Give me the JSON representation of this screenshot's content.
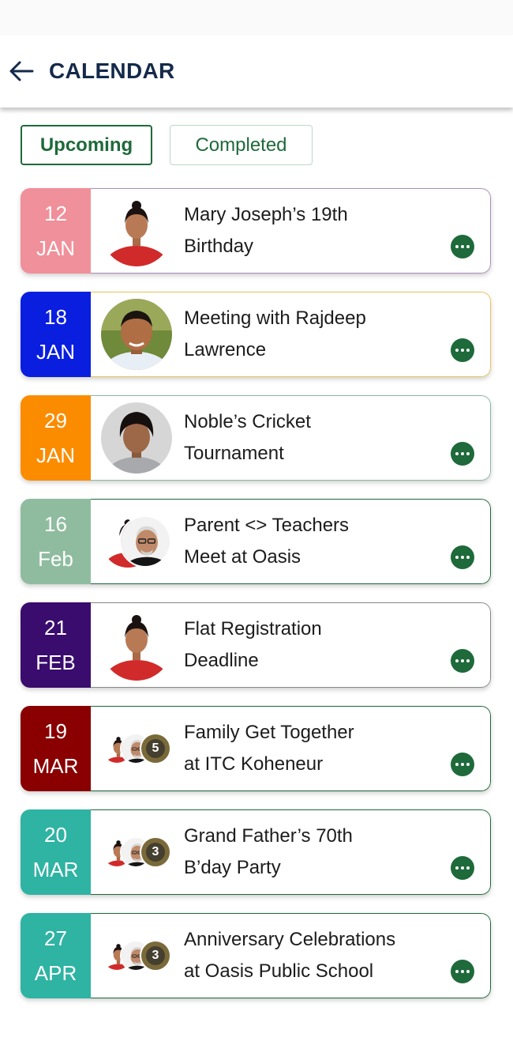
{
  "header": {
    "title": "CALENDAR",
    "back_icon": "arrow-left-icon"
  },
  "tabs": [
    {
      "label": "Upcoming",
      "active": true
    },
    {
      "label": "Completed",
      "active": false
    }
  ],
  "colors": {
    "accent": "#1e6a3a",
    "title": "#142a4a"
  },
  "events": [
    {
      "day": "12",
      "month": "JAN",
      "title_line1": "Mary Joseph’s 19th",
      "title_line2": "Birthday",
      "date_color": "#f0909a",
      "border_color": "#a88fb8",
      "avatar": "woman"
    },
    {
      "day": "18",
      "month": "JAN",
      "title_line1": "Meeting with Rajdeep",
      "title_line2": "Lawrence",
      "date_color": "#0a1ee0",
      "border_color": "#e8c45a",
      "avatar": "man"
    },
    {
      "day": "29",
      "month": "JAN",
      "title_line1": "Noble’s Cricket",
      "title_line2": "Tournament",
      "date_color": "#fb8c00",
      "border_color": "#8ab8a0",
      "avatar": "boy"
    },
    {
      "day": "16",
      "month": "Feb",
      "title_line1": "Parent <> Teachers",
      "title_line2": "Meet at Oasis",
      "date_color": "#8fbc9f",
      "border_color": "#1e6a3a",
      "avatar": "pair"
    },
    {
      "day": "21",
      "month": "FEB",
      "title_line1": "Flat Registration",
      "title_line2": "Deadline",
      "date_color": "#3a0c6e",
      "border_color": "#888888",
      "avatar": "woman"
    },
    {
      "day": "19",
      "month": "MAR",
      "title_line1": "Family Get Together",
      "title_line2": "at ITC Koheneur",
      "date_color": "#8a0000",
      "border_color": "#1e6a3a",
      "avatar": "group",
      "more_count": "5"
    },
    {
      "day": "20",
      "month": "MAR",
      "title_line1": "Grand Father’s 70th",
      "title_line2": "B’day Party",
      "date_color": "#2fb3a3",
      "border_color": "#1e6a3a",
      "avatar": "group",
      "more_count": "3"
    },
    {
      "day": "27",
      "month": "APR",
      "title_line1": "Anniversary Celebrations",
      "title_line2": "at Oasis Public School",
      "date_color": "#2fb3a3",
      "border_color": "#1e6a3a",
      "avatar": "group",
      "more_count": "3"
    }
  ]
}
